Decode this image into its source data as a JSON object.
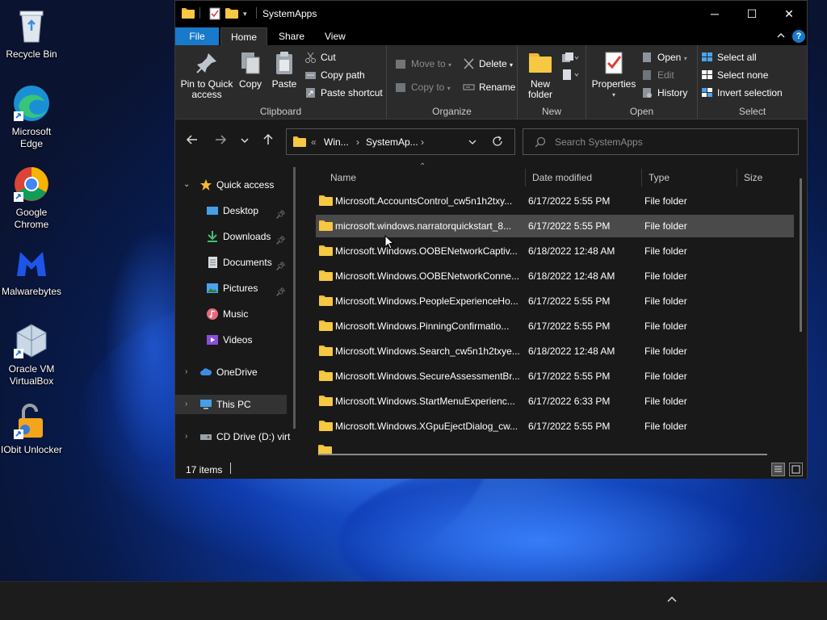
{
  "desktop": {
    "icons": [
      {
        "label": "Recycle Bin"
      },
      {
        "label": "Microsoft Edge"
      },
      {
        "label": "Google Chrome"
      },
      {
        "label": "Malwarebytes"
      },
      {
        "label": "Oracle VM VirtualBox"
      },
      {
        "label": "IObit Unlocker"
      }
    ]
  },
  "window": {
    "title": "SystemApps",
    "tabs": {
      "file": "File",
      "home": "Home",
      "share": "Share",
      "view": "View"
    },
    "controls": {
      "minimize": "─",
      "maximize": "☐",
      "close": "✕"
    }
  },
  "ribbon": {
    "clipboard": {
      "group_label": "Clipboard",
      "pin": "Pin to Quick access",
      "copy": "Copy",
      "paste": "Paste",
      "cut": "Cut",
      "copy_path": "Copy path",
      "paste_shortcut": "Paste shortcut"
    },
    "organize": {
      "group_label": "Organize",
      "move_to": "Move to",
      "copy_to": "Copy to",
      "delete": "Delete",
      "rename": "Rename"
    },
    "new": {
      "group_label": "New",
      "new_folder": "New folder"
    },
    "open": {
      "group_label": "Open",
      "properties": "Properties",
      "open": "Open",
      "edit": "Edit",
      "history": "History"
    },
    "select": {
      "group_label": "Select",
      "select_all": "Select all",
      "select_none": "Select none",
      "invert": "Invert selection"
    }
  },
  "address": {
    "prefix": "«",
    "crumb1": "Win...",
    "crumb2": "SystemAp...",
    "search_placeholder": "Search SystemApps"
  },
  "navpane": {
    "quick_access": "Quick access",
    "items": [
      {
        "label": "Desktop",
        "pinned": true
      },
      {
        "label": "Downloads",
        "pinned": true
      },
      {
        "label": "Documents",
        "pinned": true
      },
      {
        "label": "Pictures",
        "pinned": true
      },
      {
        "label": "Music",
        "pinned": false
      },
      {
        "label": "Videos",
        "pinned": false
      }
    ],
    "onedrive": "OneDrive",
    "this_pc": "This PC",
    "cd_drive": "CD Drive (D:) virt"
  },
  "columns": {
    "name": "Name",
    "date": "Date modified",
    "type": "Type",
    "size": "Size"
  },
  "files": [
    {
      "name": "Microsoft.AccountsControl_cw5n1h2txy...",
      "date": "6/17/2022 5:55 PM",
      "type": "File folder",
      "selected": false
    },
    {
      "name": "microsoft.windows.narratorquickstart_8...",
      "date": "6/17/2022 5:55 PM",
      "type": "File folder",
      "selected": true
    },
    {
      "name": "Microsoft.Windows.OOBENetworkCaptiv...",
      "date": "6/18/2022 12:48 AM",
      "type": "File folder",
      "selected": false
    },
    {
      "name": "Microsoft.Windows.OOBENetworkConne...",
      "date": "6/18/2022 12:48 AM",
      "type": "File folder",
      "selected": false
    },
    {
      "name": "Microsoft.Windows.PeopleExperienceHo...",
      "date": "6/17/2022 5:55 PM",
      "type": "File folder",
      "selected": false
    },
    {
      "name": "Microsoft.Windows.PinningConfirmatio...",
      "date": "6/17/2022 5:55 PM",
      "type": "File folder",
      "selected": false
    },
    {
      "name": "Microsoft.Windows.Search_cw5n1h2txye...",
      "date": "6/18/2022 12:48 AM",
      "type": "File folder",
      "selected": false
    },
    {
      "name": "Microsoft.Windows.SecureAssessmentBr...",
      "date": "6/17/2022 5:55 PM",
      "type": "File folder",
      "selected": false
    },
    {
      "name": "Microsoft.Windows.StartMenuExperienc...",
      "date": "6/17/2022 6:33 PM",
      "type": "File folder",
      "selected": false
    },
    {
      "name": "Microsoft.Windows.XGpuEjectDialog_cw...",
      "date": "6/17/2022 5:55 PM",
      "type": "File folder",
      "selected": false
    }
  ],
  "status": {
    "count": "17 items"
  },
  "colors": {
    "accent": "#1979ca",
    "folder": "#f6c843",
    "selected_row": "#4a4a4a",
    "window_bg": "#191919",
    "ribbon_bg": "#2b2b2b"
  }
}
